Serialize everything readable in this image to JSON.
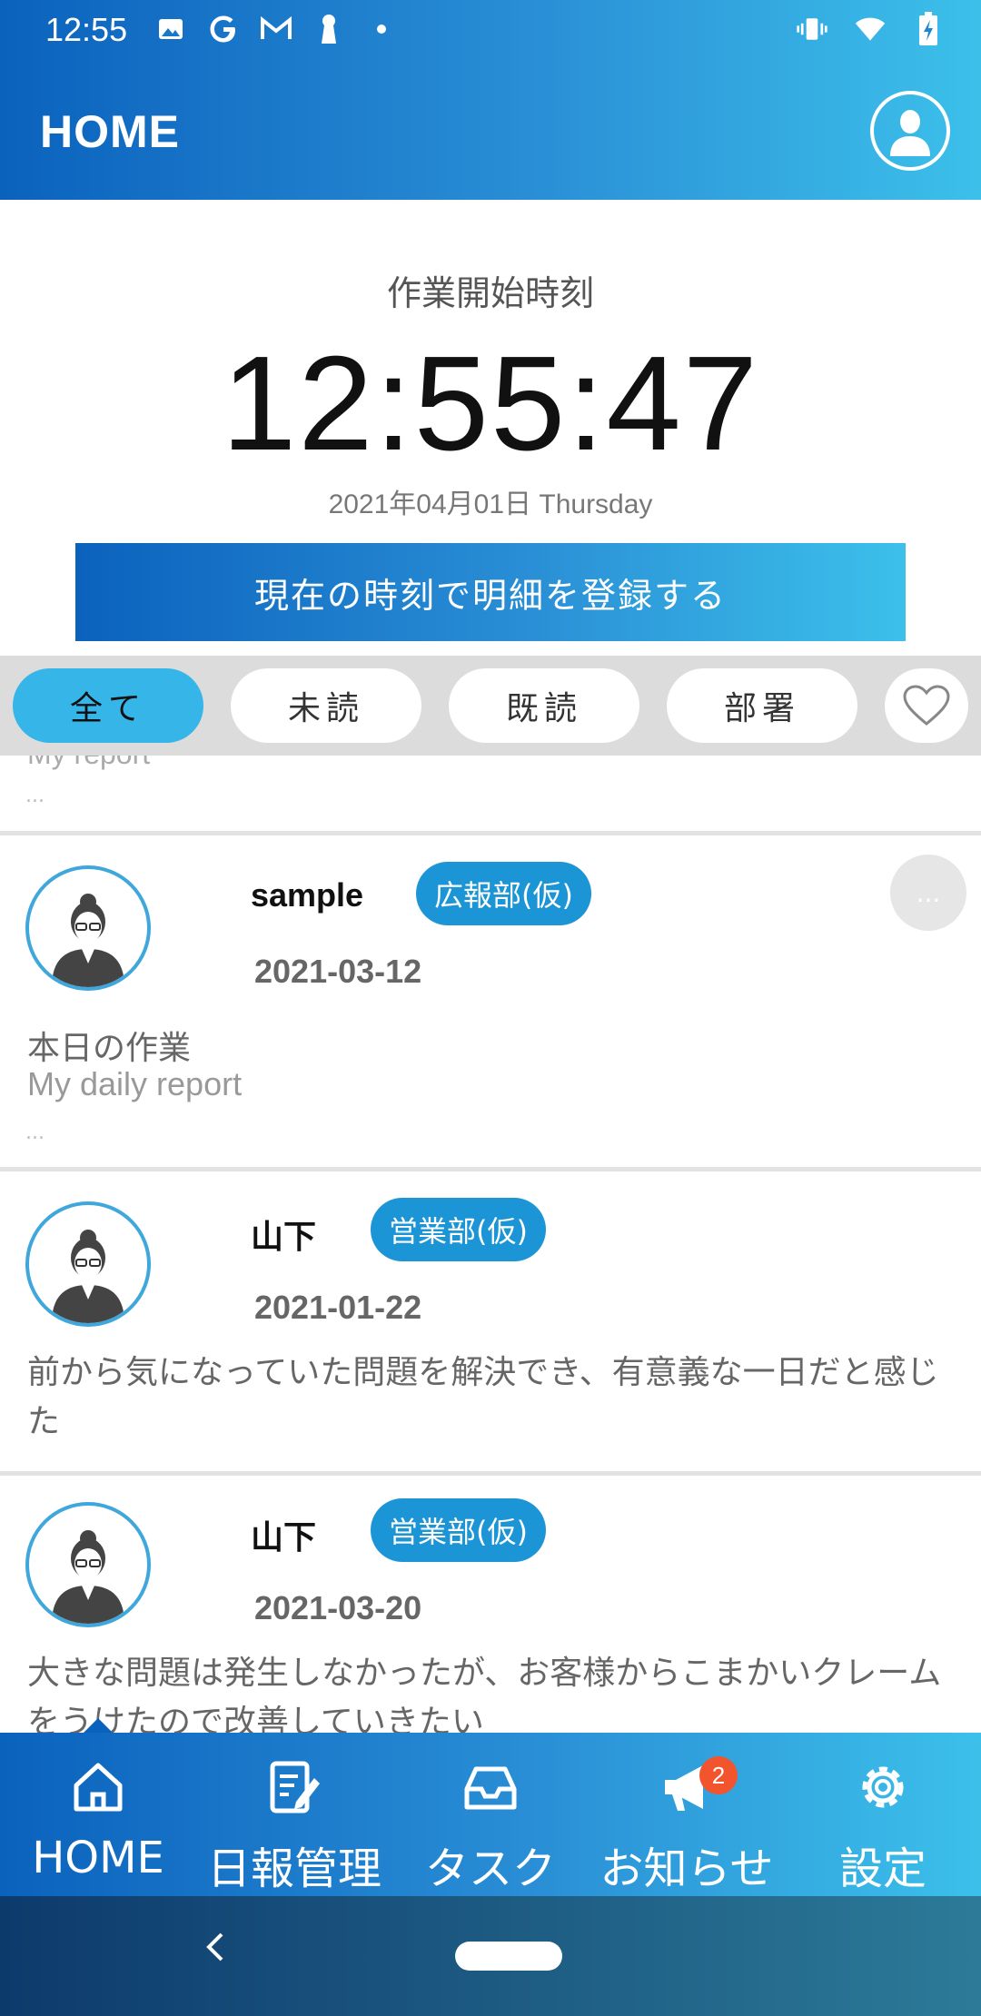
{
  "status_bar": {
    "time": "12:55",
    "icons_left": [
      "image-icon",
      "google-icon",
      "gmail-icon",
      "keyhole-icon",
      "dot-icon"
    ],
    "icons_right": [
      "vibrate-icon",
      "wifi-icon",
      "battery-charging-icon"
    ]
  },
  "header": {
    "title": "HOME",
    "profile_icon": "profile-icon"
  },
  "clock": {
    "label": "作業開始時刻",
    "time": "12:55:47",
    "date": "2021年04月01日 Thursday",
    "register_button": "現在の時刻で明細を登録する"
  },
  "filters": {
    "items": [
      "全て",
      "未読",
      "既読",
      "部署"
    ],
    "active": "全て",
    "favorite_icon": "heart-icon"
  },
  "feed": {
    "partial_top": {
      "text": "My report",
      "ellipsis": "..."
    },
    "posts": [
      {
        "author": "sample",
        "department": "広報部(仮)",
        "date": "2021-03-12",
        "more_label": "...",
        "title": "本日の作業",
        "subtitle": "My daily report",
        "ellipsis": "..."
      },
      {
        "author": "山下",
        "department": "営業部(仮)",
        "date": "2021-01-22",
        "body": "前から気になっていた問題を解決でき、有意義な一日だと感じた"
      },
      {
        "author": "山下",
        "department": "営業部(仮)",
        "date": "2021-03-20",
        "body": "大きな問題は発生しなかったが、お客様からこまかいクレームをうけたので改善していきたい"
      }
    ]
  },
  "tabbar": {
    "items": [
      {
        "label": "HOME",
        "icon": "home-icon"
      },
      {
        "label": "日報管理",
        "icon": "report-edit-icon"
      },
      {
        "label": "タスク",
        "icon": "inbox-icon"
      },
      {
        "label": "お知らせ",
        "icon": "megaphone-icon",
        "badge": "2"
      },
      {
        "label": "設定",
        "icon": "gear-icon"
      }
    ],
    "active": "HOME"
  },
  "system_nav": {
    "back_icon": "back-chevron-icon",
    "home_icon": "home-pill-icon"
  },
  "colors": {
    "brand_dark": "#0b62bd",
    "brand_light": "#3cc0ea",
    "active_filter": "#36b5e8",
    "dept_badge": "#1c95d6",
    "notification_badge": "#f2542d"
  }
}
